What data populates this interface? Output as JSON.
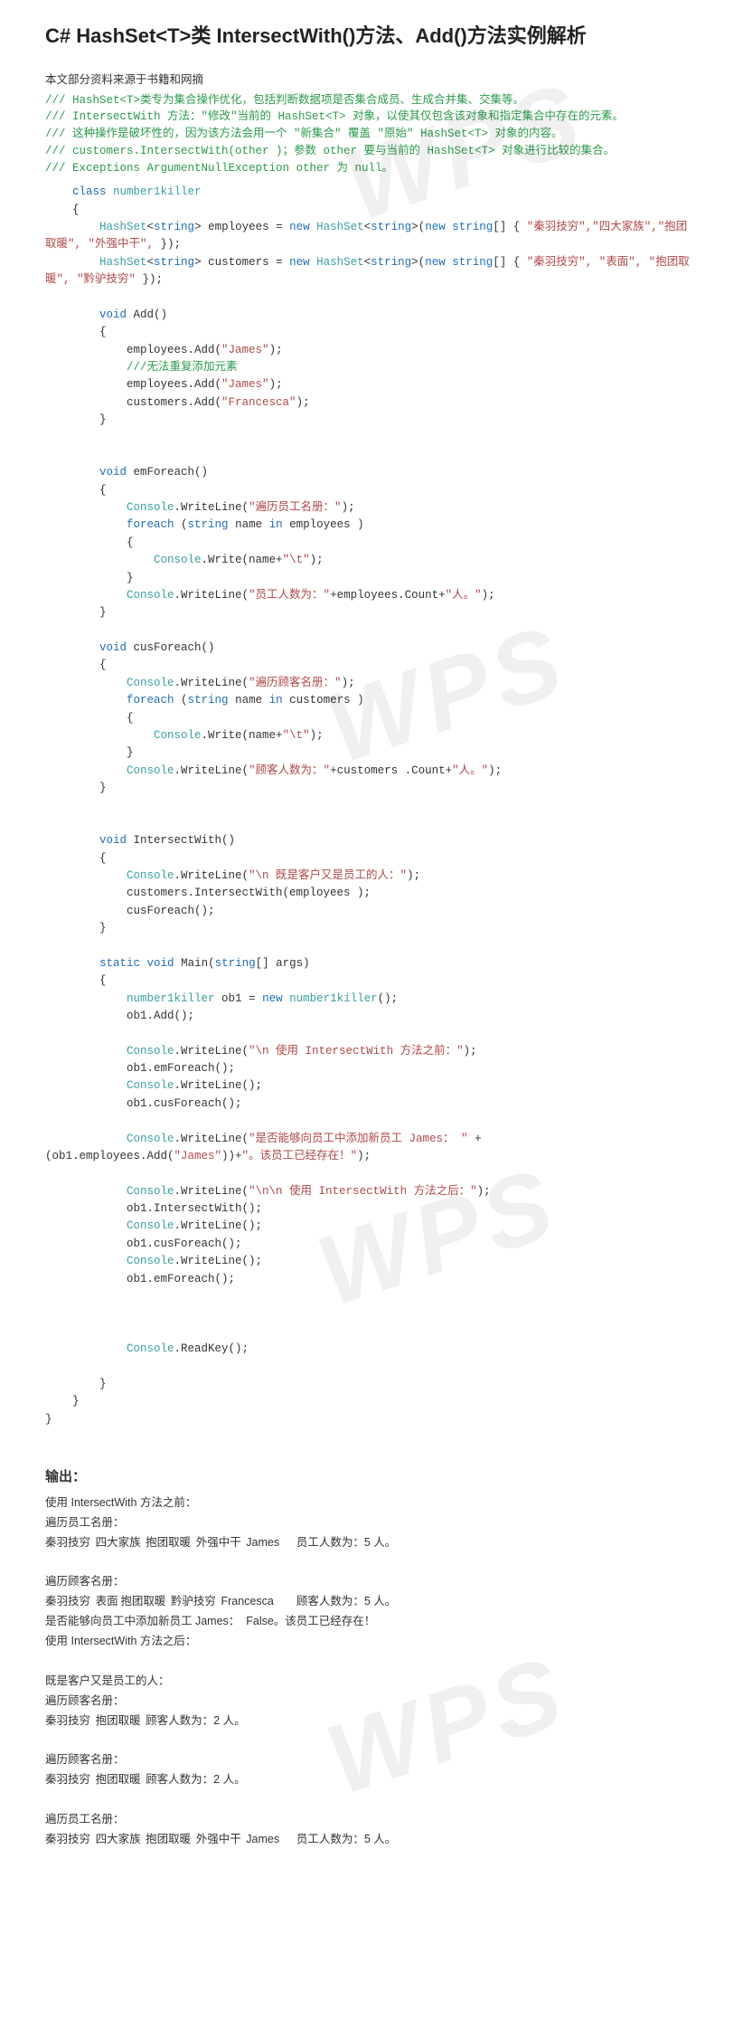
{
  "title": "C# HashSet<T>类 IntersectWith()方法、Add()方法实例解析",
  "intro": "本文部分资料来源于书籍和网摘",
  "comments": [
    "/// HashSet<T>类专为集合操作优化，包括判断数据项是否集合成员、生成合并集、交集等。",
    "/// IntersectWith 方法：\"修改\"当前的 HashSet<T> 对象，以使其仅包含该对象和指定集合中存在的元素。",
    "/// 这种操作是破坏性的，因为该方法会用一个 \"新集合\" 覆盖 \"原始\" HashSet<T> 对象的内容。",
    "///   customers.IntersectWith(other )；参数 other 要与当前的 HashSet<T> 对象进行比较的集合。",
    "/// Exceptions ArgumentNullException  other 为 null。"
  ],
  "code": {
    "class_decl": "class number1killer",
    "emp_decl_prefix": "HashSet<string> employees = new HashSet<string>(new string[] { ",
    "emp_items": "\"秦羽技穷\",\"四大家族\",\"抱团取暖\", \"外强中干\", ",
    "emp_suffix": "});",
    "cus_decl_prefix": "HashSet<string> customers = new HashSet<string>(new string[] { ",
    "cus_items": "\"秦羽技穷\", \"表面\", \"抱团取暖\", \"黔驴技穷\" ",
    "cus_suffix": "});",
    "add_sig": "void Add()",
    "add_body1": "employees.Add(\"James\");",
    "add_cmt": "///无法重复添加元素",
    "add_body2": "employees.Add(\"James\");",
    "add_body3": "customers.Add(\"Francesca\");",
    "emf_sig": "void emForeach()",
    "emf_l1": "Console.WriteLine(\"遍历员工名册：\");",
    "emf_l2": "foreach (string name in employees )",
    "emf_l3": "Console.Write(name+\"\\t\");",
    "emf_l4": "Console.WriteLine(\"员工人数为：\"+employees.Count+\"人。\");",
    "cuf_sig": "void cusForeach()",
    "cuf_l1": "Console.WriteLine(\"遍历顾客名册：\");",
    "cuf_l2": "foreach (string name in customers )",
    "cuf_l3": "Console.Write(name+\"\\t\");",
    "cuf_l4": "Console.WriteLine(\"顾客人数为：\"+customers .Count+\"人。\");",
    "iw_sig": "void IntersectWith()",
    "iw_l1": "Console.WriteLine(\"\\n 既是客户又是员工的人：\");",
    "iw_l2": "customers.IntersectWith(employees );",
    "iw_l3": "cusForeach();",
    "main_sig": "static void Main(string[] args)",
    "main_l1": "number1killer ob1 = new number1killer();",
    "main_l2": "ob1.Add();",
    "main_l3": "Console.WriteLine(\"\\n 使用 IntersectWith 方法之前：\");",
    "main_l4": "ob1.emForeach();",
    "main_l5": "Console.WriteLine();",
    "main_l6": "ob1.cusForeach();",
    "main_l7a": "Console.WriteLine(\"是否能够向员工中添加新员工 James： \" +",
    "main_l7b": "(ob1.employees.Add(\"James\"))+\"。该员工已经存在！\");",
    "main_l8": "Console.WriteLine(\"\\n\\n 使用 IntersectWith 方法之后：\");",
    "main_l9": "ob1.IntersectWith();",
    "main_l10": "Console.WriteLine();",
    "main_l11": "ob1.cusForeach();",
    "main_l12": "Console.WriteLine();",
    "main_l13": "ob1.emForeach();",
    "main_readkey": "Console.ReadKey();"
  },
  "output": {
    "header": "输出：",
    "lines": [
      "使用 IntersectWith 方法之前：",
      "遍历员工名册：",
      "秦羽技穷\t四大家族\t抱团取暖\t外强中干\tJames\t员工人数为：5 人。",
      "",
      "遍历顾客名册：",
      "秦羽技穷\t表面\t抱团取暖\t黔驴技穷\tFrancesca\t顾客人数为：5 人。",
      "是否能够向员工中添加新员工 James：  False。该员工已经存在！",
      "使用 IntersectWith 方法之后：",
      "",
      "既是客户又是员工的人：",
      "遍历顾客名册：",
      "秦羽技穷\t抱团取暖\t顾客人数为：2 人。",
      "",
      "遍历顾客名册：",
      "秦羽技穷\t抱团取暖\t顾客人数为：2 人。",
      "",
      "遍历员工名册：",
      "秦羽技穷\t四大家族\t抱团取暖\t外强中干\tJames\t员工人数为：5 人。"
    ]
  },
  "watermark": "WPS"
}
